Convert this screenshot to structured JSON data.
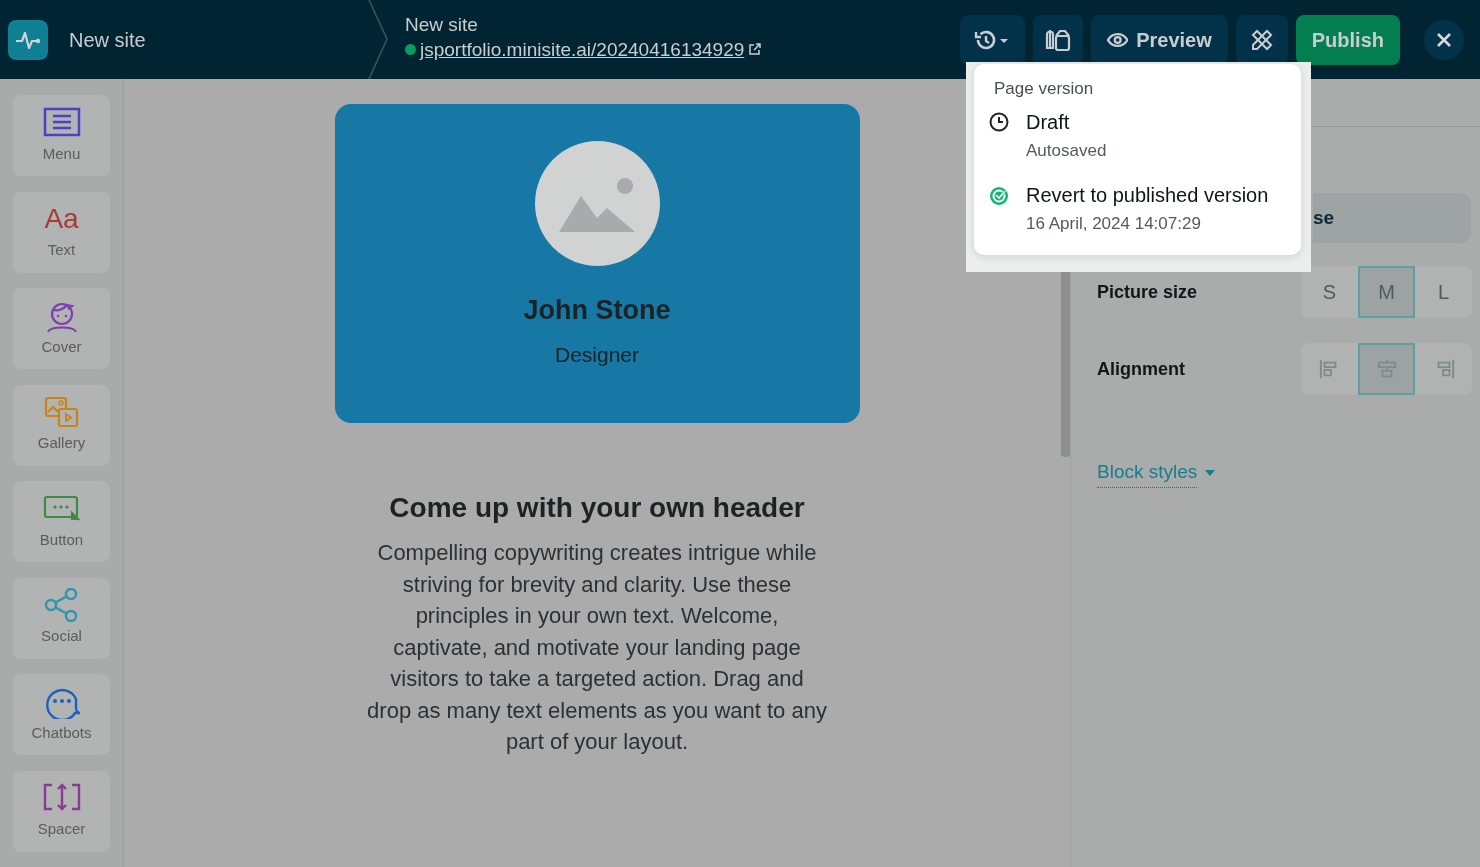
{
  "topbar": {
    "site_name": "New site",
    "page_title": "New site",
    "url": "jsportfolio.minisite.ai/20240416134929",
    "url_published": true,
    "preview": "Preview",
    "publish": "Publish"
  },
  "sidebar": {
    "items": [
      {
        "kind": "menu",
        "label": "Menu"
      },
      {
        "kind": "text",
        "glyph": "Aa",
        "label": "Text"
      },
      {
        "kind": "cover",
        "label": "Cover"
      },
      {
        "kind": "gallery",
        "label": "Gallery"
      },
      {
        "kind": "button",
        "label": "Button"
      },
      {
        "kind": "social",
        "label": "Social"
      },
      {
        "kind": "chatbots",
        "label": "Chatbots"
      },
      {
        "kind": "spacer",
        "label": "Spacer"
      }
    ]
  },
  "canvas": {
    "name": "John Stone",
    "role": "Designer",
    "header": "Come up with your own header",
    "paragraph": "Compelling copywriting creates intrigue while striving for brevity and clarity. Use these principles in your own text. Welcome, captivate, and motivate your landing page visitors to take a targeted action. Drag and drop as many text elements as you want to any part of your layout."
  },
  "settings": {
    "partial_button": "se",
    "rows": [
      {
        "kind": "size",
        "label": "Picture size",
        "options": [
          {
            "label": "S",
            "selected": false
          },
          {
            "label": "M",
            "selected": true
          },
          {
            "label": "L",
            "selected": false
          }
        ]
      },
      {
        "kind": "align",
        "label": "Alignment",
        "options": [
          {
            "selected": false
          },
          {
            "selected": true
          },
          {
            "selected": false
          }
        ]
      }
    ],
    "block_styles": "Block styles"
  },
  "version_menu": {
    "title": "Page version",
    "items": [
      {
        "kind": "draft",
        "title": "Draft",
        "subtitle": "Autosaved"
      },
      {
        "kind": "published",
        "title": "Revert to published version",
        "subtitle": "16 April, 2024 14:07:29"
      }
    ]
  }
}
